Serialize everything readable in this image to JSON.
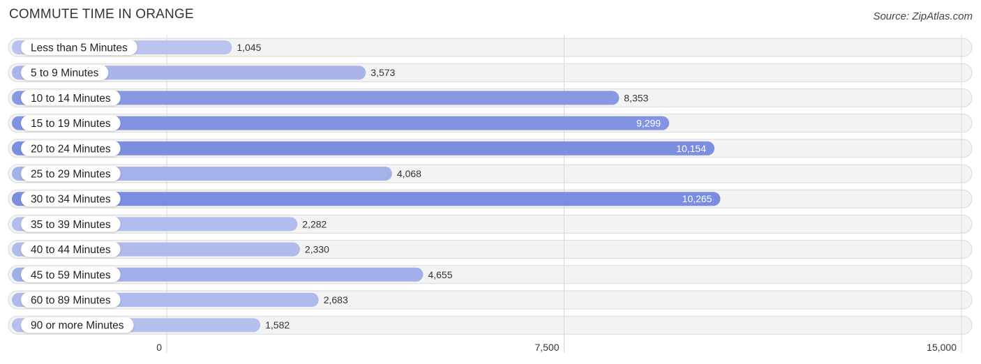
{
  "header": {
    "title": "COMMUTE TIME IN ORANGE",
    "source": "Source: ZipAtlas.com"
  },
  "chart_data": {
    "type": "bar",
    "orientation": "horizontal",
    "title": "COMMUTE TIME IN ORANGE",
    "xlabel": "",
    "ylabel": "",
    "categories": [
      "Less than 5 Minutes",
      "5 to 9 Minutes",
      "10 to 14 Minutes",
      "15 to 19 Minutes",
      "20 to 24 Minutes",
      "25 to 29 Minutes",
      "30 to 34 Minutes",
      "35 to 39 Minutes",
      "40 to 44 Minutes",
      "45 to 59 Minutes",
      "60 to 89 Minutes",
      "90 or more Minutes"
    ],
    "values": [
      1045,
      3573,
      8353,
      9299,
      10154,
      4068,
      10265,
      2282,
      2330,
      4655,
      2683,
      1582
    ],
    "value_labels": [
      "1,045",
      "3,573",
      "8,353",
      "9,299",
      "10,154",
      "4,068",
      "10,265",
      "2,282",
      "2,330",
      "4,655",
      "2,683",
      "1,582"
    ],
    "xlim": [
      0,
      15000
    ],
    "xticks": [
      0,
      7500,
      15000
    ],
    "xtick_labels": [
      "0",
      "7,500",
      "15,000"
    ],
    "grid": true,
    "legend": "none",
    "colors": {
      "low": "#b9c3ee",
      "high": "#7b8de0"
    }
  }
}
